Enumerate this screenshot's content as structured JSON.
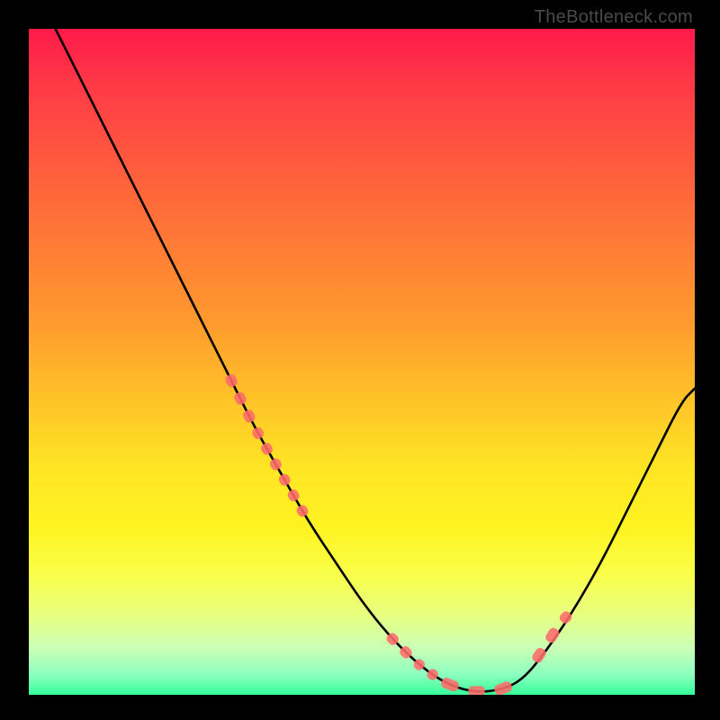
{
  "meta": {
    "watermark": "TheBottleneck.com"
  },
  "chart_data": {
    "type": "line",
    "title": "",
    "xlabel": "",
    "ylabel": "",
    "xlim": [
      0,
      100
    ],
    "ylim": [
      0,
      100
    ],
    "grid": false,
    "legend": false,
    "background_gradient": {
      "stops": [
        {
          "offset": 0.0,
          "color": "#ff1a4a"
        },
        {
          "offset": 0.2,
          "color": "#ff5a3e"
        },
        {
          "offset": 0.44,
          "color": "#ff9a2e"
        },
        {
          "offset": 0.66,
          "color": "#ffe524"
        },
        {
          "offset": 0.82,
          "color": "#f9ff4a"
        },
        {
          "offset": 0.93,
          "color": "#caffb6"
        },
        {
          "offset": 1.0,
          "color": "#33ff99"
        }
      ]
    },
    "series": [
      {
        "name": "bottleneck-curve",
        "stroke": "#000000",
        "x": [
          4,
          7,
          10,
          14,
          18,
          22,
          26,
          30,
          34,
          38,
          42,
          46,
          50,
          54,
          58,
          62,
          66,
          70,
          74,
          78,
          82,
          86,
          90,
          94,
          98,
          100
        ],
        "y": [
          100,
          94,
          88,
          80,
          72,
          64,
          56,
          48,
          40,
          33,
          26,
          20,
          14,
          9,
          5,
          2,
          0.5,
          0.5,
          2,
          7,
          13,
          20,
          28,
          36,
          44,
          46
        ]
      },
      {
        "name": "highlight-left",
        "stroke": "#ff6b6b",
        "style": "dashed-blocks",
        "x": [
          30,
          34,
          38,
          42
        ],
        "y": [
          48,
          40,
          33,
          26
        ]
      },
      {
        "name": "highlight-bottom",
        "stroke": "#ff6b6b",
        "style": "dashed-blocks",
        "x": [
          54,
          58,
          62,
          66,
          70,
          74
        ],
        "y": [
          9,
          5,
          2,
          0.5,
          0.5,
          2
        ]
      },
      {
        "name": "highlight-right",
        "stroke": "#ff6b6b",
        "style": "dashed-blocks",
        "x": [
          76,
          80,
          82
        ],
        "y": [
          5,
          11,
          13
        ]
      }
    ]
  }
}
